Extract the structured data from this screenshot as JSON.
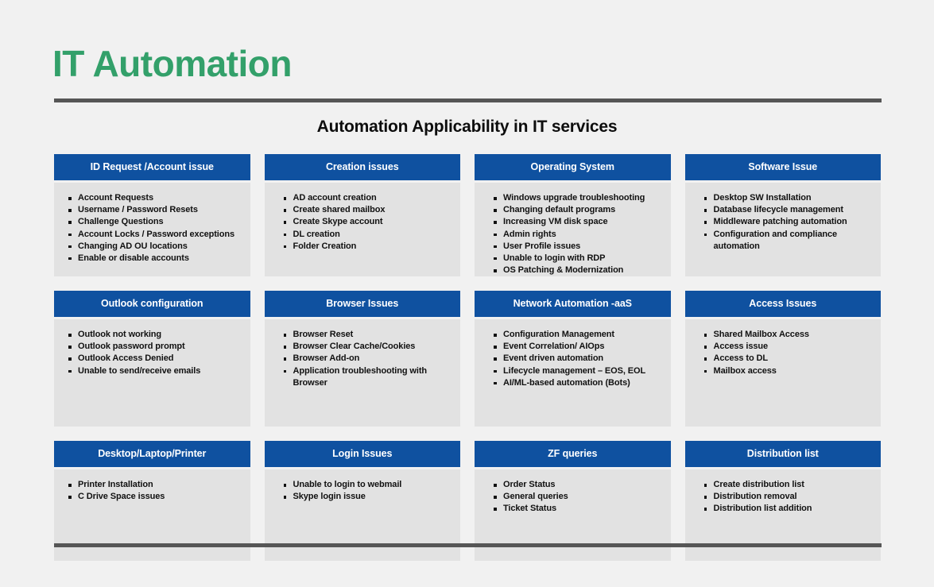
{
  "title": "IT Automation",
  "subtitle": "Automation Applicability in IT services",
  "colors": {
    "title_green": "#33a06a",
    "header_blue": "#0f51a0",
    "card_gray": "#e2e2e2",
    "page_background": "#f1f1f1",
    "rule_gray": "#565656"
  },
  "rows": [
    {
      "cards": [
        {
          "header": "ID Request /Account issue",
          "items": [
            "Account Requests",
            "Username / Password Resets",
            "Challenge Questions",
            "Account Locks / Password exceptions",
            "Changing AD OU locations",
            "Enable or disable accounts"
          ]
        },
        {
          "header": "Creation issues",
          "items": [
            "AD account creation",
            "Create shared mailbox",
            "Create Skype account",
            "DL creation",
            "Folder Creation"
          ]
        },
        {
          "header": "Operating System",
          "items": [
            "Windows upgrade troubleshooting",
            "Changing default programs",
            "Increasing VM disk space",
            "Admin rights",
            "User Profile issues",
            "Unable to login with RDP",
            "OS Patching & Modernization"
          ]
        },
        {
          "header": "Software Issue",
          "items": [
            "Desktop SW Installation",
            "Database  lifecycle management",
            "Middleware patching automation",
            "Configuration and compliance automation"
          ]
        }
      ]
    },
    {
      "cards": [
        {
          "header": "Outlook configuration",
          "items": [
            "Outlook not working",
            "Outlook password prompt",
            "Outlook Access Denied",
            "Unable to send/receive emails"
          ]
        },
        {
          "header": "Browser Issues",
          "items": [
            "Browser Reset",
            "Browser Clear Cache/Cookies",
            "Browser Add-on",
            "Application troubleshooting with Browser"
          ]
        },
        {
          "header": "Network Automation -aaS",
          "items": [
            "Configuration Management",
            "Event Correlation/ AIOps",
            "Event driven automation",
            "Lifecycle management – EOS, EOL",
            "AI/ML-based automation (Bots)"
          ]
        },
        {
          "header": "Access Issues",
          "items": [
            "Shared Mailbox Access",
            "Access issue",
            "Access to DL",
            "Mailbox access"
          ]
        }
      ]
    },
    {
      "cards": [
        {
          "header": "Desktop/Laptop/Printer",
          "items": [
            "Printer Installation",
            "C Drive Space issues"
          ]
        },
        {
          "header": "Login Issues",
          "items": [
            "Unable to login to webmail",
            "Skype login issue"
          ]
        },
        {
          "header": "ZF queries",
          "items": [
            "Order Status",
            "General queries",
            "Ticket Status"
          ]
        },
        {
          "header": "Distribution list",
          "items": [
            "Create distribution list",
            "Distribution removal",
            "Distribution list addition"
          ]
        }
      ]
    }
  ]
}
